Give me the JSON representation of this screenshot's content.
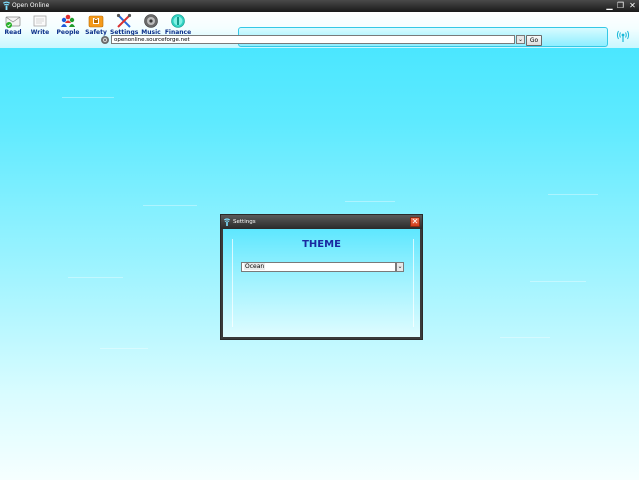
{
  "window": {
    "title": "Open Online",
    "controls": {
      "minimize": "▁",
      "restore": "❐",
      "close": "✕"
    }
  },
  "toolbar": {
    "items": [
      {
        "label": "Read",
        "icon": "read-icon"
      },
      {
        "label": "Write",
        "icon": "write-icon"
      },
      {
        "label": "People",
        "icon": "people-icon"
      },
      {
        "label": "Safety",
        "icon": "safety-icon"
      },
      {
        "label": "Settings",
        "icon": "settings-icon"
      },
      {
        "label": "Music",
        "icon": "music-icon"
      },
      {
        "label": "Finance",
        "icon": "finance-icon"
      }
    ]
  },
  "address": {
    "value": "openonline.sourceforge.net",
    "dropdown_glyph": "⌄",
    "go_label": "Go"
  },
  "dialog": {
    "title": "Settings",
    "close_glyph": "✕",
    "heading": "THEME",
    "theme_value": "Ocean",
    "dropdown_glyph": "⌄"
  },
  "colors": {
    "accent": "#1a2aa0",
    "toolbar_label": "#0a2f8a",
    "background_top": "#3fe4ff",
    "background_bottom": "#f6ffff",
    "close_button": "#d03a1a"
  }
}
